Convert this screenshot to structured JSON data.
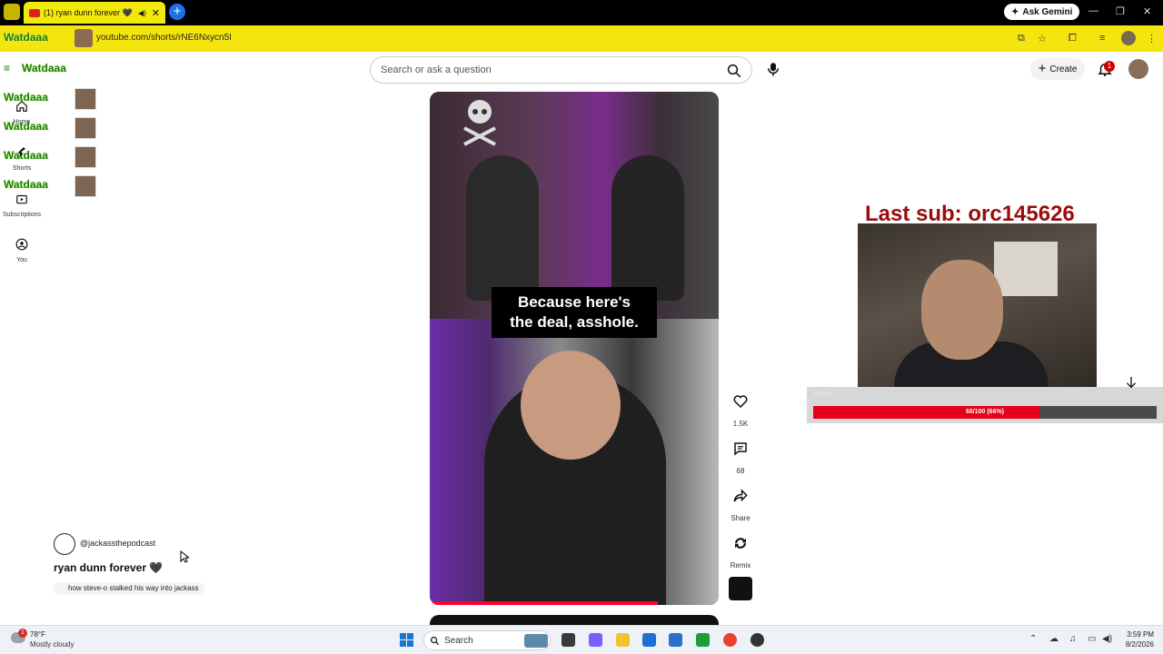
{
  "browser": {
    "tab_title": "(1) ryan dunn forever 🖤 -",
    "new_tab_symbol": "+",
    "gemini_label": "Ask Gemini",
    "window_controls": [
      "—",
      "❐",
      "✕"
    ],
    "url": "youtube.com/shorts/rNE6Nxycn5I",
    "overlay_logo": "Watdaaa"
  },
  "masthead": {
    "search_placeholder": "Search or ask a question",
    "create_label": "Create",
    "notification_count": "1"
  },
  "guide": {
    "items": [
      {
        "label": "Home",
        "icon": "home-icon"
      },
      {
        "label": "Shorts",
        "icon": "shorts-icon"
      },
      {
        "label": "Subscriptions",
        "icon": "subscriptions-icon"
      },
      {
        "label": "You",
        "icon": "you-icon"
      }
    ]
  },
  "overlay_rows": [
    "Watdaaa",
    "Watdaaa",
    "Watdaaa",
    "Watdaaa",
    "Watdaaa"
  ],
  "video": {
    "caption_line1": "Because here's",
    "caption_line2": "the deal, asshole.",
    "progress": 0.79
  },
  "actions": {
    "likes": "1.5K",
    "comments": "68",
    "share_label": "Share",
    "remix_label": "Remix"
  },
  "meta": {
    "channel_handle": "@jackassthepodcast",
    "title": "ryan dunn forever 🖤",
    "related": "how steve-o stalked his way into jackass"
  },
  "stream": {
    "last_sub": "Last sub: orc145626",
    "goal_label": "Follows",
    "goal_text": "66/100 (66%)",
    "goal_fraction": 0.66
  },
  "taskbar": {
    "weather_badge": "1",
    "temperature": "78°F",
    "condition": "Mostly cloudy",
    "search_placeholder": "Search",
    "time": "3:59 PM",
    "date": "8/2/2026"
  },
  "colors": {
    "accent_yellow": "#f5e50e",
    "brand_red": "#ff0033",
    "goal_red": "#e60019",
    "last_sub_red": "#9b0c0c"
  }
}
